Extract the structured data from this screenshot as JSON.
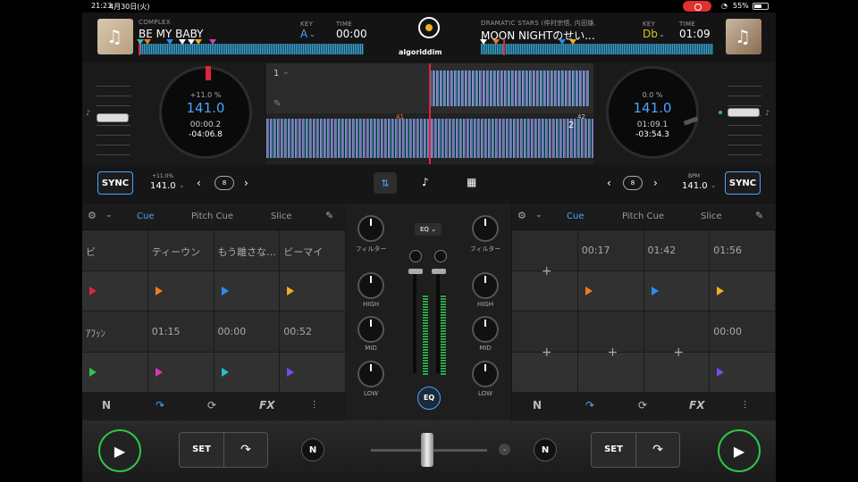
{
  "status": {
    "time": "21:23",
    "date": "4月30日(火)",
    "battery": "55%"
  },
  "deckA": {
    "artist": "COMPLEX",
    "title": "BE MY BABY",
    "key_label": "KEY",
    "key": "A",
    "time_label": "TIME",
    "time": "00:00",
    "pitch_pct": "+11.0 %",
    "bpm": "141.0",
    "elapsed": "00:00.2",
    "remaining": "-04:06.8",
    "sync_pitch": "+11.0%",
    "sync_bpm": "141.0",
    "loop": "8",
    "tabs": [
      "Cue",
      "Pitch Cue",
      "Slice"
    ],
    "pads_row1": [
      "ビ",
      "ティーウン",
      "もう離さな...",
      "ビーマイ"
    ],
    "pads_row2": [
      "ｱﾌｯﾝ",
      "01:15",
      "00:00",
      "00:52"
    ],
    "colors_row1": [
      "#e0243b",
      "#ee7a1e",
      "#2a8cf0",
      "#f0b020"
    ],
    "colors_row2": [
      "#2fc54a",
      "#d43ab8",
      "#28c0c0",
      "#7a4af0"
    ]
  },
  "deckB": {
    "artist": "DRAMATIC STARS (仲村宗悟, 内田雄...",
    "title": "MOON NIGHTのせい...",
    "key_label": "KEY",
    "key": "Db",
    "time_label": "TIME",
    "time": "01:09",
    "pitch_pct": "0.0 %",
    "bpm": "141.0",
    "elapsed": "01:09.1",
    "remaining": "-03:54.3",
    "bpm_label": "BPM",
    "sync_bpm": "141.0",
    "loop": "8",
    "tabs": [
      "Cue",
      "Pitch Cue",
      "Slice"
    ],
    "pads_row1": [
      "",
      "00:17",
      "01:42",
      "01:56"
    ],
    "pads_row2": [
      "",
      "",
      "",
      "00:00"
    ],
    "colors_row1": [
      "",
      "#ee7a1e",
      "#2a8cf0",
      "#f0b020"
    ],
    "colors_row2": [
      "",
      "",
      "",
      "#7a4af0"
    ]
  },
  "logo": "algoriddim",
  "sync_label": "SYNC",
  "wave": {
    "track_num": "1",
    "bar1": "41",
    "bar2": "42",
    "deck2": "2"
  },
  "mixer": {
    "eq_select": "EQ",
    "filter_label": "フィルター",
    "high_label": "HIGH",
    "mid_label": "MID",
    "low_label": "LOW",
    "eq_button": "EQ"
  },
  "transport": {
    "set_label": "SET"
  }
}
